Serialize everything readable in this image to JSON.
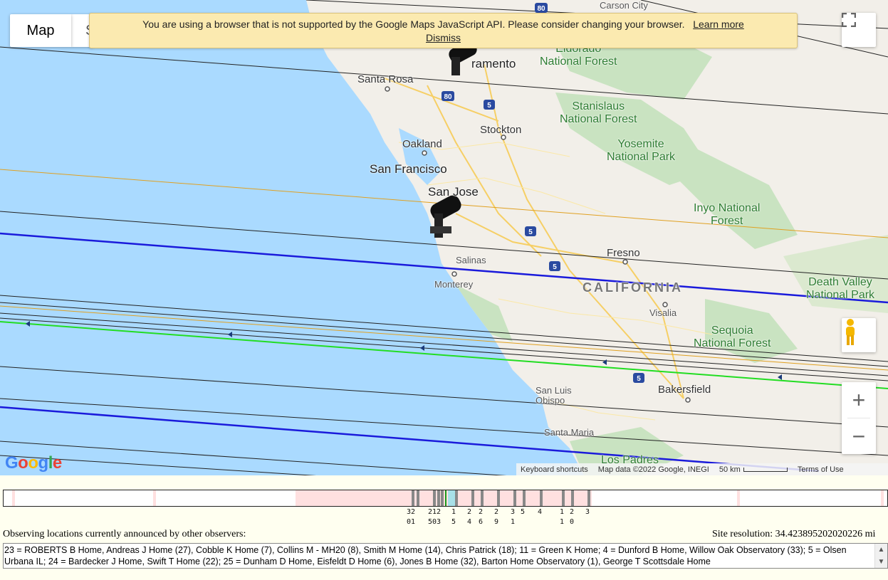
{
  "map": {
    "type_label": "Map",
    "satellite_label": "S",
    "warning": {
      "text": "You are using a browser that is not supported by the Google Maps JavaScript API. Please consider changing your browser.",
      "learn_more": "Learn more",
      "dismiss": "Dismiss"
    },
    "places": {
      "carson_city": "Carson City",
      "eldorado_forest": "Eldorado\nNational Forest",
      "sacramento": "ramento",
      "santa_rosa": "Santa Rosa",
      "stanislaus": "Stanislaus\nNational Forest",
      "stockton": "Stockton",
      "oakland": "Oakland",
      "yosemite": "Yosemite\nNational Park",
      "san_francisco": "San Francisco",
      "san_jose": "San Jose",
      "inyo": "Inyo National\nForest",
      "fresno": "Fresno",
      "salinas": "Salinas",
      "monterey": "Monterey",
      "california": "CALIFORNIA",
      "death_valley": "Death Valley\nNational Park",
      "visalia": "Visalia",
      "sequoia": "Sequoia\nNational Forest",
      "san_luis_obispo": "San Luis\nObispo",
      "bakersfield": "Bakersfield",
      "santa_maria": "Santa Maria",
      "los_padres": "Los Padres"
    },
    "highways": [
      "80",
      "80",
      "5",
      "5",
      "5",
      "5"
    ],
    "google_logo": "Google",
    "attribution": {
      "keyboard": "Keyboard shortcuts",
      "data": "Map data ©2022 Google, INEGI",
      "scale": "50 km",
      "terms": "Terms of Use"
    },
    "controls": {
      "fullscreen_icon": "fullscreen-icon",
      "pegman_icon": "pegman-icon",
      "zoom_in": "+",
      "zoom_out": "−"
    },
    "colors": {
      "water": "#aadaff",
      "land": "#f2efe9",
      "forest": "#c9e3c1",
      "track_black": "#222222",
      "track_orange": "#e0a020",
      "track_blue": "#1a1adb",
      "track_green": "#22dd22"
    }
  },
  "timeline": {
    "labels": [
      {
        "top": "32",
        "bottom": "01"
      },
      {
        "top": "212",
        "bottom": "503"
      },
      {
        "top": "1",
        "bottom": "5"
      },
      {
        "top": "2",
        "bottom": "4"
      },
      {
        "top": "2",
        "bottom": "6"
      },
      {
        "top": "2",
        "bottom": "9"
      },
      {
        "top": "3",
        "bottom": "1"
      },
      {
        "top": "5",
        "bottom": ""
      },
      {
        "top": "4",
        "bottom": ""
      },
      {
        "top": "1",
        "bottom": "1"
      },
      {
        "top": "2",
        "bottom": "0"
      },
      {
        "top": "3",
        "bottom": ""
      }
    ]
  },
  "observers": {
    "heading": "Observing locations currently announced by other observers:",
    "resolution": "Site resolution: 34.423895202020226 mi",
    "list": "23 = ROBERTS B Home, Andreas J Home (27), Cobble K Home (7), Collins M - MH20 (8), Smith M Home (14), Chris Patrick (18); 11 = Green K Home; 4 = Dunford B Home, Willow Oak Observatory (33); 5 = Olsen Urbana IL; 24 = Bardecker J Home, Swift T Home (22); 25 = Dunham D Home, Eisfeldt D Home (6), Jones B Home (32), Barton Home Observatory (1), George T Scottsdale Home"
  }
}
